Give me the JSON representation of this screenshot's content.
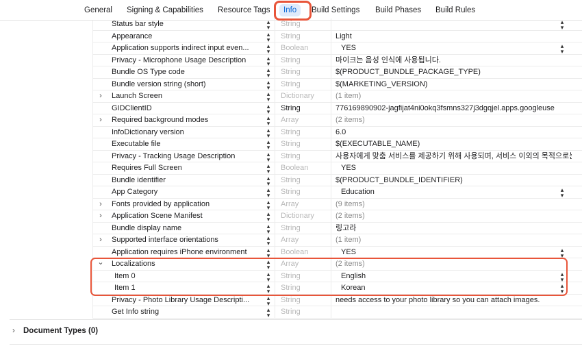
{
  "tabs": [
    {
      "label": "General",
      "active": false
    },
    {
      "label": "Signing & Capabilities",
      "active": false
    },
    {
      "label": "Resource Tags",
      "active": false
    },
    {
      "label": "Info",
      "active": true
    },
    {
      "label": "Build Settings",
      "active": false
    },
    {
      "label": "Build Phases",
      "active": false
    },
    {
      "label": "Build Rules",
      "active": false
    }
  ],
  "rows": [
    {
      "key": "Status bar style",
      "type": "String",
      "value": "",
      "disclosure": "",
      "value_stepper": true
    },
    {
      "key": "Appearance",
      "type": "String",
      "value": "Light",
      "disclosure": "",
      "value_stepper": false
    },
    {
      "key": "Application supports indirect input even...",
      "type": "Boolean",
      "value": "YES",
      "disclosure": "",
      "value_stepper": true
    },
    {
      "key": "Privacy - Microphone Usage Description",
      "type": "String",
      "value": "마이크는 음성 인식에 사용됩니다.",
      "disclosure": "",
      "value_stepper": false
    },
    {
      "key": "Bundle OS Type code",
      "type": "String",
      "value": "$(PRODUCT_BUNDLE_PACKAGE_TYPE)",
      "disclosure": "",
      "value_stepper": false
    },
    {
      "key": "Bundle version string (short)",
      "type": "String",
      "value": "$(MARKETING_VERSION)",
      "disclosure": "",
      "value_stepper": false
    },
    {
      "key": "Launch Screen",
      "type": "Dictionary",
      "value": "(1 item)",
      "disclosure": ">",
      "value_stepper": false
    },
    {
      "key": "GIDClientID",
      "type": "String",
      "value": "776169890902-jagfijat4ni0okq3fsmns327j3dgqjel.apps.googleuse",
      "disclosure": "",
      "value_stepper": false
    },
    {
      "key": "Required background modes",
      "type": "Array",
      "value": "(2 items)",
      "disclosure": ">",
      "value_stepper": false
    },
    {
      "key": "InfoDictionary version",
      "type": "String",
      "value": "6.0",
      "disclosure": "",
      "value_stepper": false
    },
    {
      "key": "Executable file",
      "type": "String",
      "value": "$(EXECUTABLE_NAME)",
      "disclosure": "",
      "value_stepper": false
    },
    {
      "key": "Privacy - Tracking Usage Description",
      "type": "String",
      "value": "사용자에게 맞춤 서비스를 제공하기 위해 사용되며, 서비스 이외의 목적으로는 절디",
      "disclosure": "",
      "value_stepper": false
    },
    {
      "key": "Requires Full Screen",
      "type": "Boolean",
      "value": "YES",
      "disclosure": "",
      "value_stepper": false
    },
    {
      "key": "Bundle identifier",
      "type": "String",
      "value": "$(PRODUCT_BUNDLE_IDENTIFIER)",
      "disclosure": "",
      "value_stepper": false
    },
    {
      "key": "App Category",
      "type": "String",
      "value": "Education",
      "disclosure": "",
      "value_stepper": true
    },
    {
      "key": "Fonts provided by application",
      "type": "Array",
      "value": "(9 items)",
      "disclosure": ">",
      "value_stepper": false
    },
    {
      "key": "Application Scene Manifest",
      "type": "Dictionary",
      "value": "(2 items)",
      "disclosure": ">",
      "value_stepper": false
    },
    {
      "key": "Bundle display name",
      "type": "String",
      "value": "링고라",
      "disclosure": "",
      "value_stepper": false
    },
    {
      "key": "Supported interface orientations",
      "type": "Array",
      "value": "(1 item)",
      "disclosure": ">",
      "value_stepper": false
    },
    {
      "key": "Application requires iPhone environment",
      "type": "Boolean",
      "value": "YES",
      "disclosure": "",
      "value_stepper": true
    },
    {
      "key": "Localizations",
      "type": "Array",
      "value": "(2 items)",
      "disclosure": "v",
      "value_stepper": false
    },
    {
      "key": "Item 0",
      "type": "String",
      "value": "English",
      "disclosure": "",
      "value_stepper": true,
      "sub": true
    },
    {
      "key": "Item 1",
      "type": "String",
      "value": "Korean",
      "disclosure": "",
      "value_stepper": true,
      "sub": true
    },
    {
      "key": "Privacy - Photo Library Usage Descripti...",
      "type": "String",
      "value": "needs access to your photo library so you can attach images.",
      "disclosure": "",
      "value_stepper": false
    },
    {
      "key": "Get Info string",
      "type": "String",
      "value": "",
      "disclosure": "",
      "value_stepper": false
    }
  ],
  "document_types": {
    "label": "Document Types (0)"
  },
  "colors": {
    "accent": "#0a68d6",
    "highlight": "#e8553a"
  }
}
